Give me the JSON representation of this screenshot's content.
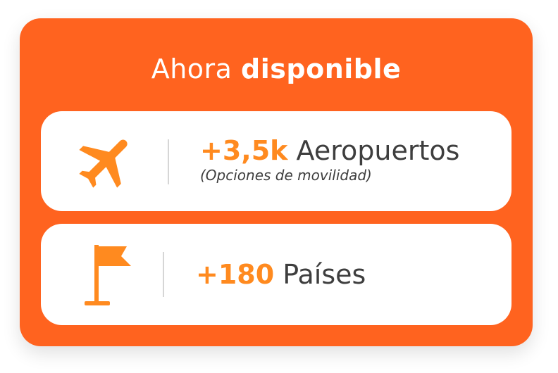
{
  "header": {
    "title_prefix": "Ahora",
    "title_emphasis": "disponible"
  },
  "stats": [
    {
      "icon": "airplane-icon",
      "value": "+3,5k",
      "label": "Aeropuertos",
      "note": "(Opciones de movilidad)"
    },
    {
      "icon": "flag-icon",
      "value": "+180",
      "label": "Países"
    }
  ],
  "colors": {
    "card_background": "#ff631f",
    "accent": "#ff8a1f",
    "text_dark": "#3e3e3e"
  }
}
